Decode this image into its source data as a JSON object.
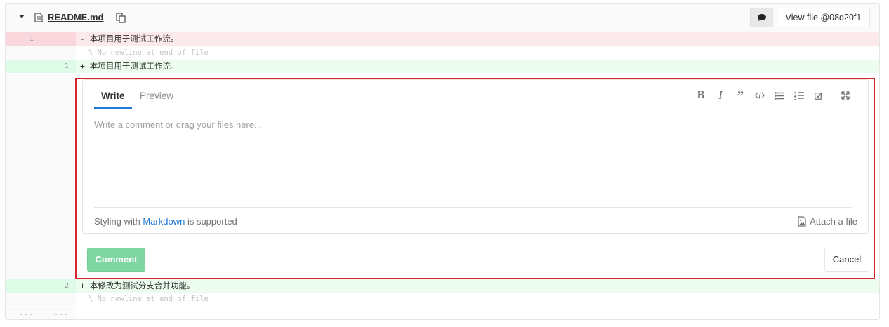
{
  "file": {
    "name": "README.md",
    "view_file_label": "View file @08d20f1"
  },
  "diff": {
    "lines": [
      {
        "type": "removed",
        "old": "1",
        "new": "",
        "text": "- 本项目用于测试工作流。"
      },
      {
        "type": "meta",
        "old": "",
        "new": "",
        "text": "\\ No newline at end of file"
      },
      {
        "type": "added",
        "old": "",
        "new": "1",
        "text": "+ 本项目用于测试工作流。"
      }
    ],
    "lines_after": [
      {
        "type": "added",
        "old": "",
        "new": "2",
        "text": "+ 本修改为测试分支合并功能。"
      },
      {
        "type": "meta",
        "old": "",
        "new": "",
        "text": "\\ No newline at end of file"
      },
      {
        "type": "dots",
        "old": "...",
        "new": "...",
        "text": ""
      }
    ]
  },
  "editor": {
    "tab_write": "Write",
    "tab_preview": "Preview",
    "placeholder": "Write a comment or drag your files here...",
    "hint_prefix": "Styling with ",
    "hint_link": "Markdown",
    "hint_suffix": " is supported",
    "attach_label": "Attach a file",
    "toolbar_icons": [
      "bold-icon",
      "italic-icon",
      "quote-icon",
      "code-icon",
      "bullet-list-icon",
      "numbered-list-icon",
      "task-list-icon",
      "fullscreen-icon"
    ]
  },
  "actions": {
    "comment_label": "Comment",
    "cancel_label": "Cancel"
  },
  "colors": {
    "highlight_border": "#d9242c",
    "link": "#1f78d1",
    "comment_button": "#7fd6a2",
    "removed_bg": "#fbe9eb",
    "added_bg": "#ecfdf0"
  }
}
